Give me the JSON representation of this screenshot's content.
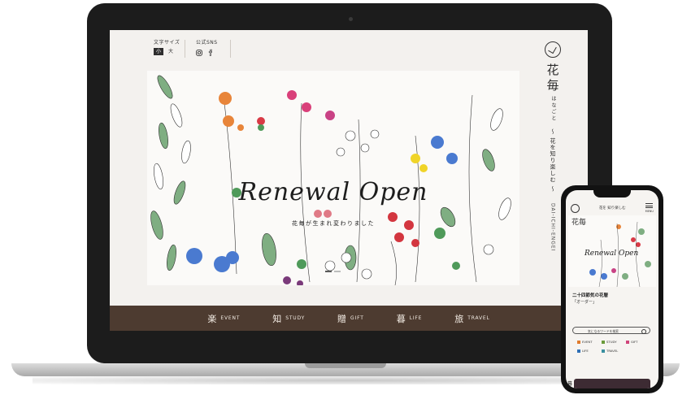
{
  "header": {
    "font_size_label": "文字サイズ",
    "size_small": "小",
    "size_large": "大",
    "sns_label": "公式SNS"
  },
  "hero": {
    "title": "Renewal Open",
    "subtitle": "花毎が生まれ変わりました"
  },
  "brand": {
    "kanji_1": "花",
    "kanji_2": "毎",
    "kana": "はなごと",
    "tagline": "〜 花を知り楽しむ 〜",
    "latin": "DAI-ICHI-ENGEI"
  },
  "nav": [
    {
      "kanji": "楽",
      "label": "EVENT"
    },
    {
      "kanji": "知",
      "label": "STUDY"
    },
    {
      "kanji": "贈",
      "label": "GIFT"
    },
    {
      "kanji": "暮",
      "label": "LIFE"
    },
    {
      "kanji": "旅",
      "label": "TRAVEL"
    }
  ],
  "phone": {
    "tagline": "花を 知り楽しむ",
    "menu_label": "MENU",
    "hero_kanji": "花毎",
    "hero_title": "Renewal Open",
    "headline": "二十四節気の花暦",
    "headline_sub": "「オーダー」",
    "search_placeholder": "気になるワードを検索",
    "categories": [
      {
        "label": "EVENT",
        "color": "#e07b2d"
      },
      {
        "label": "STUDY",
        "color": "#6a9a3a"
      },
      {
        "label": "GIFT",
        "color": "#d0447a"
      },
      {
        "label": "LIFE",
        "color": "#2f6fb5"
      },
      {
        "label": "TRAVEL",
        "color": "#3a8fa0"
      }
    ],
    "card_kanji": "暮"
  },
  "colors": {
    "nav_bg": "#4d3b30",
    "screen_bg": "#f3f1ee"
  }
}
